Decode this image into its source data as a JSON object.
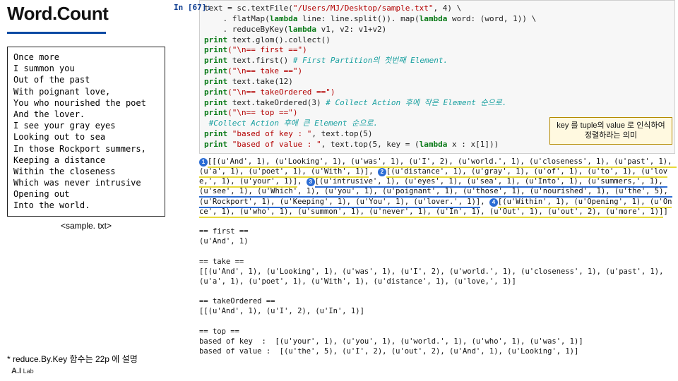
{
  "title": "Word.Count",
  "poem": "Once more\nI summon you\nOut of the past\nWith poignant love,\nYou who nourished the poet\nAnd the lover.\nI see your gray eyes\nLooking out to sea\nIn those Rockport summers,\nKeeping a distance\nWithin the closeness\nWhich was never intrusive\nOpening out\nInto the world.",
  "sample_label": "<sample. txt>",
  "note": "* reduce.By.Key 함수는 22p 에 설명",
  "lab": {
    "ai": "A.I",
    "word": "Lab"
  },
  "in_label": "In [67]:",
  "code": {
    "l1_pre": "text = sc.textFile(",
    "l1_str": "\"/Users/MJ/Desktop/sample.txt\"",
    "l1_post": ", 4) \\",
    "l2_pre": "    . flatMap(",
    "l2_lam": "lambda",
    "l2_mid": " line: line.split()). map(",
    "l2_lam2": "lambda",
    "l2_end": " word: (word, 1)) \\",
    "l3_pre": "    . reduceByKey(",
    "l3_lam": "lambda",
    "l3_end": " v1, v2: v1+v2)",
    "l4_kw": "print",
    "l4_rest": " text.glom().collect()",
    "l5_kw": "print",
    "l5_str": "(\"\\n== first ==\")",
    "l6_kw": "print",
    "l6_rest": " text.first() ",
    "l6_cm": "# First Partition의 첫번째 Element.",
    "l7_kw": "print",
    "l7_str": "(\"\\n== take ==\")",
    "l8_kw": "print",
    "l8_rest": " text.take(12)",
    "l9_kw": "print",
    "l9_str": "(\"\\n== takeOrdered ==\")",
    "l10_kw": "print",
    "l10_rest": " text.takeOrdered(3) ",
    "l10_cm": "# Collect Action 후에 작은 Element 순으로.",
    "l11_kw": "print",
    "l11_str": "(\"\\n== top ==\")",
    "l12_cm": " #Collect Action 후에 큰 Element 순으로.",
    "l13_kw": "print",
    "l13_pre": " ",
    "l13_str": "\"based of key : \"",
    "l13_rest": ", text.top(5)",
    "l14_kw": "print",
    "l14_pre": " ",
    "l14_str": "\"based of value : \"",
    "l14_mid": ", text.top(5, key = (",
    "l14_lam": "lambda",
    "l14_end": " x : x[1]))"
  },
  "callout": "key 를 tuple의 value 로 인식하여\n정렬하라는 의미",
  "out": {
    "bl1_a": "[[(u'And', 1), (u'Looking', 1), (u'was', 1), (u'I', 2), (u'world.', 1), (u'closeness', 1), (u'past', 1), (u'a', 1), (u'poet', 1), (u'With', 1)]",
    "bl1_b": "[(u'distance', 1), (u'gray', 1), (u'of', 1), (u'to', 1), (u'love,', 1), (u'your', 1)]",
    "bl1_c": "[(u'intrusive', 1), (u'eyes', 1), (u'sea', 1), (u'Into', 1), (u'summers,', 1), (u'see', 1), (u'Which', 1), (u'you', 1), (u'poignant', 1), (u'those', 1), (u'nourished', 1), (u'the', 5), (u'Rockport', 1), (u'Keeping', 1), (u'You', 1), (u'lover.', 1)]",
    "bl1_d": "[(u'Within', 1), (u'Opening', 1), (u'Once', 1), (u'who', 1), (u'summon', 1), (u'never', 1), (u'In', 1), (u'Out', 1), (u'out', 2), (u'more', 1)]",
    "first_hdr": "== first ==",
    "first_val": "(u'And', 1)",
    "take_hdr": "== take ==",
    "take_val": "[[(u'And', 1), (u'Looking', 1), (u'was', 1), (u'I', 2), (u'world.', 1), (u'closeness', 1), (u'past', 1), (u'a', 1), (u'poet', 1), (u'With', 1), (u'distance', 1), (u'love,', 1)]",
    "to_hdr": "== takeOrdered ==",
    "to_val": "[[(u'And', 1), (u'I', 2), (u'In', 1)]",
    "top_hdr": "== top ==",
    "top_key": "based of key  :  [(u'your', 1), (u'you', 1), (u'world.', 1), (u'who', 1), (u'was', 1)]",
    "top_val": "based of value :  [(u'the', 5), (u'I', 2), (u'out', 2), (u'And', 1), (u'Looking', 1)]"
  },
  "badges": {
    "b1": "1",
    "b2": "2",
    "b3": "3",
    "b4": "4"
  }
}
